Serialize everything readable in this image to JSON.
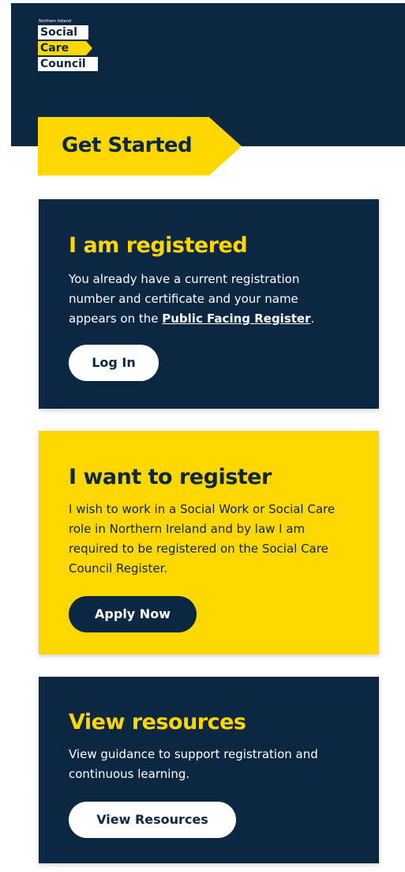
{
  "logo": {
    "tagline": "Northern Ireland",
    "line1": "Social",
    "line2": "Care",
    "line3": "Council"
  },
  "banner": {
    "title": "Get Started"
  },
  "cards": [
    {
      "title": "I am registered",
      "text_before": "You already have a current registration number and certificate and your name appears on the ",
      "link": "Public Facing Register",
      "text_after": ".",
      "button": "Log In"
    },
    {
      "title": "I want to register",
      "text": "I wish to work in a Social Work or Social Care role in Northern Ireland and by law I am required to be registered on the Social Care Council Register.",
      "button": "Apply Now"
    },
    {
      "title": "View resources",
      "text": "View guidance to support registration and continuous learning.",
      "button": "View Resources"
    }
  ],
  "colors": {
    "navy": "#0b2742",
    "yellow": "#ffd700",
    "white": "#ffffff"
  }
}
